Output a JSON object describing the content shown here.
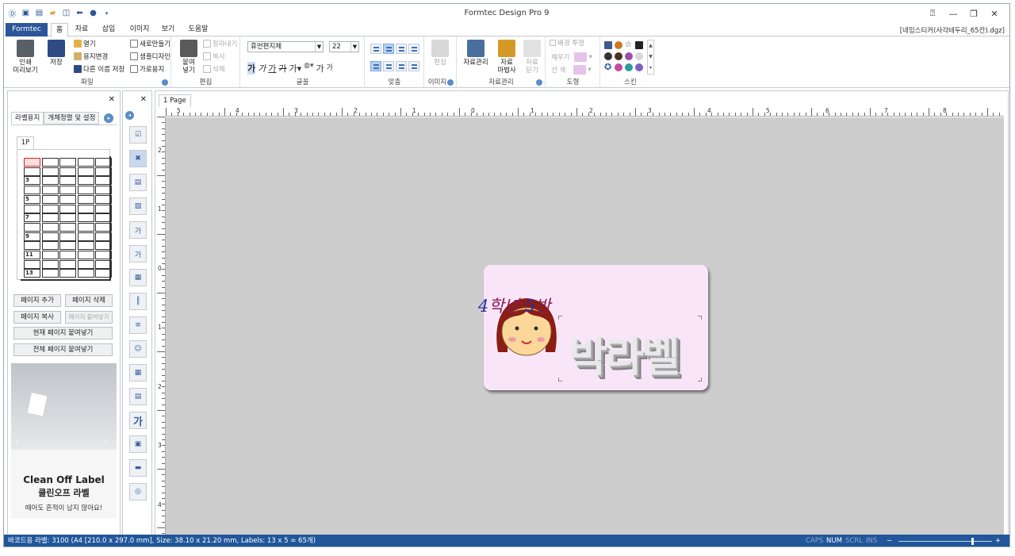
{
  "window": {
    "title": "Formtec Design Pro 9",
    "doc_name": "[네임스티커(사각테두리_65칸).dgz]"
  },
  "tabs": [
    "Formtec",
    "홈",
    "자료",
    "삽입",
    "이미지",
    "보기",
    "도움말"
  ],
  "ribbon": {
    "file": {
      "label": "파일",
      "print": "인쇄\n미리보기",
      "save": "저장",
      "open": "열기",
      "paper_change": "용지변경",
      "save_as": "다른 이름 저장",
      "new": "새로만들기",
      "sample": "샘플디자인",
      "landscape": "가로용지"
    },
    "edit": {
      "label": "편집",
      "paste": "붙여\n넣기",
      "cut": "잘라내기",
      "copy": "복사",
      "delete": "삭제"
    },
    "font": {
      "label": "글꼴",
      "family": "휴먼편지체",
      "size": "22"
    },
    "align": {
      "label": "맞춤"
    },
    "image": {
      "label": "이미지",
      "edit": "편집"
    },
    "data": {
      "label": "자료관리",
      "manage": "자료관리",
      "wizard": "자료\n마법사",
      "close": "자료\n닫기"
    },
    "shape": {
      "label": "도형",
      "bg_transparent": "배경 투명",
      "fill": "채우기",
      "line": "선 색"
    },
    "skin": {
      "label": "스킨"
    }
  },
  "left_panel": {
    "tabs": [
      "라벨용지",
      "개체정렬 및 설정"
    ],
    "page_tab": "1P",
    "row_numbers": [
      "3",
      "5",
      "7",
      "9",
      "11",
      "13"
    ],
    "buttons": {
      "add_page": "페이지 추가",
      "delete_page": "페이지 삭제",
      "copy_page": "페이지 복사",
      "paste_page": "페이지 붙여넣기",
      "paste_current": "현재 페이지 붙여넣기",
      "paste_all": "전체 페이지 붙여넣기"
    },
    "ad": {
      "brand": "Clean Off Label",
      "product": "클린오프 라벨",
      "tagline": "떼어도 흔적이 남지 않아요!"
    }
  },
  "canvas": {
    "tab": "1 Page",
    "hruler": [
      "5",
      "4",
      "3",
      "2",
      "1",
      "0",
      "1",
      "2",
      "3",
      "4",
      "5",
      "6",
      "7",
      "8"
    ],
    "vruler": [
      "2",
      "1",
      "0",
      "1",
      "2",
      "3",
      "4"
    ],
    "label": {
      "class_num1": "4",
      "class_word1": "학년 ",
      "class_num2": "5",
      "class_word2": "반",
      "name": "박라벨"
    }
  },
  "status": {
    "info": "바코드용 라벨: 3100 (A4 [210.0 x 297.0 mm], Size: 38.10 x 21.20 mm,  Labels: 13 x 5 = 65개)",
    "caps": "CAPS",
    "num": "NUM",
    "scrl": "SCRL",
    "ins": "INS",
    "zoom_minus": "−",
    "zoom_plus": "+"
  }
}
